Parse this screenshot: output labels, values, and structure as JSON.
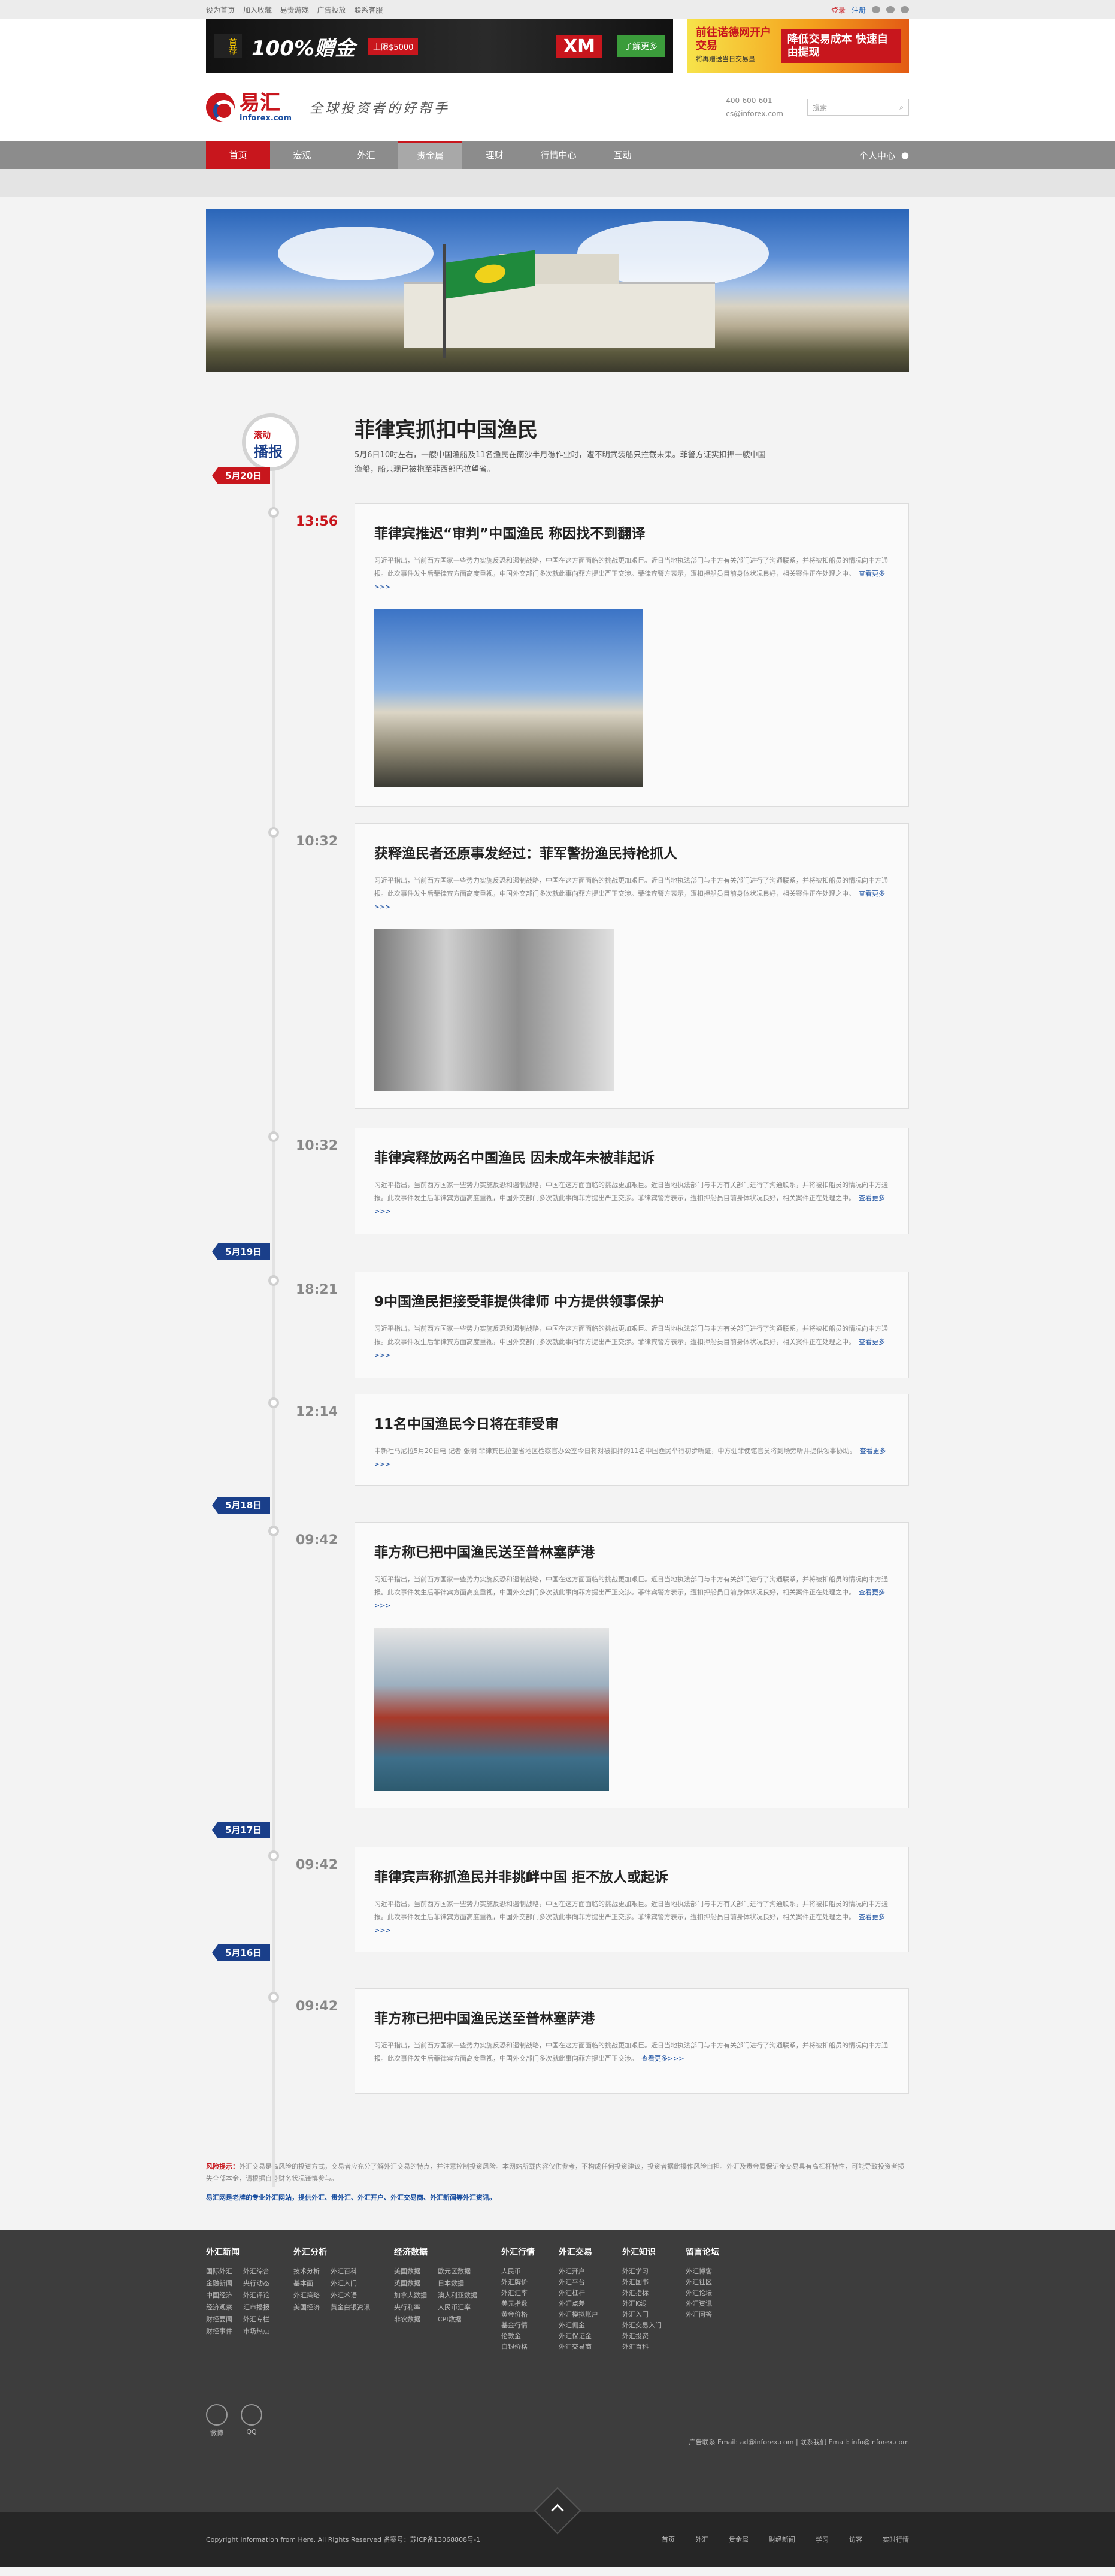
{
  "topbar": {
    "links": [
      "设为首页",
      "加入收藏",
      "易贵游戏",
      "广告投放",
      "联系客服"
    ],
    "register": "登录",
    "login": "注册"
  },
  "ads": {
    "ad1_label": "首荐",
    "ad1_big": "100%赠金",
    "ad1_sub": "上限$5000",
    "ad1_brand": "XM",
    "ad1_go": "了解更多",
    "ad2_left": "前往诺德网开户交易",
    "ad2_left_small": "将再赠送当日交易量",
    "ad2_right": "降低交易成本 快速自由提现"
  },
  "header": {
    "logo_cn": "易汇",
    "logo_en": "inforex.com",
    "slogan": "全球投资者的好帮手",
    "phone": "400-600-601",
    "email": "cs@inforex.com",
    "search_placeholder": "搜索"
  },
  "nav": {
    "items": [
      "首页",
      "宏观",
      "外汇",
      "贵金属",
      "理财",
      "行情中心",
      "互动"
    ],
    "user": "个人中心"
  },
  "article": {
    "badge_1": "滚动",
    "badge_2": "播报",
    "title": "菲律宾抓扣中国渔民",
    "lead": "5月6日10时左右，一艘中国渔船及11名渔民在南沙半月礁作业时，遭不明武装船只拦截未果。菲警方证实扣押一艘中国渔船，船只现已被拖至菲西部巴拉望省。"
  },
  "dates": [
    "5月20日",
    "5月19日",
    "5月18日",
    "5月17日",
    "5月16日"
  ],
  "entries": [
    {
      "time": "13:56",
      "title": "菲律宾推迟“审判”中国渔民 称因找不到翻译",
      "body": "习近平指出，当前西方国家一些势力实施反恐和遏制战略，中国在这方面面临的挑战更加艰巨。近日当地执法部门与中方有关部门进行了沟通联系，并将被扣船员的情况向中方通报。此次事件发生后菲律宾方面高度重视，中国外交部门多次就此事向菲方提出严正交涉。菲律宾警方表示，遭扣押船员目前身体状况良好，相关案件正在处理之中。",
      "more": "查看更多>>>"
    },
    {
      "time": "10:32",
      "title": "获释渔民者还原事发经过：菲军警扮渔民持枪抓人",
      "body": "习近平指出，当前西方国家一些势力实施反恐和遏制战略，中国在这方面面临的挑战更加艰巨。近日当地执法部门与中方有关部门进行了沟通联系，并将被扣船员的情况向中方通报。此次事件发生后菲律宾方面高度重视，中国外交部门多次就此事向菲方提出严正交涉。菲律宾警方表示，遭扣押船员目前身体状况良好，相关案件正在处理之中。",
      "more": "查看更多>>>"
    },
    {
      "time": "10:32",
      "title": "菲律宾释放两名中国渔民 因未成年未被菲起诉",
      "body": "习近平指出，当前西方国家一些势力实施反恐和遏制战略，中国在这方面面临的挑战更加艰巨。近日当地执法部门与中方有关部门进行了沟通联系，并将被扣船员的情况向中方通报。此次事件发生后菲律宾方面高度重视，中国外交部门多次就此事向菲方提出严正交涉。菲律宾警方表示，遭扣押船员目前身体状况良好，相关案件正在处理之中。",
      "more": "查看更多>>>"
    },
    {
      "time": "18:21",
      "title": "9中国渔民拒接受菲提供律师 中方提供领事保护",
      "body": "习近平指出，当前西方国家一些势力实施反恐和遏制战略，中国在这方面面临的挑战更加艰巨。近日当地执法部门与中方有关部门进行了沟通联系，并将被扣船员的情况向中方通报。此次事件发生后菲律宾方面高度重视，中国外交部门多次就此事向菲方提出严正交涉。菲律宾警方表示，遭扣押船员目前身体状况良好，相关案件正在处理之中。",
      "more": "查看更多>>>"
    },
    {
      "time": "12:14",
      "title": "11名中国渔民今日将在菲受审",
      "body": "中新社马尼拉5月20日电 记者 张明 菲律宾巴拉望省地区检察官办公室今日将对被扣押的11名中国渔民举行初步听证，中方驻菲使馆官员将到场旁听并提供领事协助。",
      "more": "查看更多>>>"
    },
    {
      "time": "09:42",
      "title": "菲方称已把中国渔民送至普林塞萨港",
      "body": "习近平指出，当前西方国家一些势力实施反恐和遏制战略，中国在这方面面临的挑战更加艰巨。近日当地执法部门与中方有关部门进行了沟通联系，并将被扣船员的情况向中方通报。此次事件发生后菲律宾方面高度重视，中国外交部门多次就此事向菲方提出严正交涉。菲律宾警方表示，遭扣押船员目前身体状况良好，相关案件正在处理之中。",
      "more": "查看更多>>>"
    },
    {
      "time": "09:42",
      "title": "菲律宾声称抓渔民并非挑衅中国 拒不放人或起诉",
      "body": "习近平指出，当前西方国家一些势力实施反恐和遏制战略，中国在这方面面临的挑战更加艰巨。近日当地执法部门与中方有关部门进行了沟通联系，并将被扣船员的情况向中方通报。此次事件发生后菲律宾方面高度重视，中国外交部门多次就此事向菲方提出严正交涉。菲律宾警方表示，遭扣押船员目前身体状况良好，相关案件正在处理之中。",
      "more": "查看更多>>>"
    },
    {
      "time": "09:42",
      "title": "菲方称已把中国渔民送至普林塞萨港",
      "body": "习近平指出，当前西方国家一些势力实施反恐和遏制战略，中国在这方面面临的挑战更加艰巨。近日当地执法部门与中方有关部门进行了沟通联系，并将被扣船员的情况向中方通报。此次事件发生后菲律宾方面高度重视，中国外交部门多次就此事向菲方提出严正交涉。",
      "more": "查看更多>>>"
    }
  ],
  "risk": {
    "label": "风险提示：",
    "text": "外汇交易是高风险的投资方式，交易者应充分了解外汇交易的特点，并注意控制投资风险。本网站所载内容仅供参考，不构成任何投资建议，投资者据此操作风险自担。外汇及贵金属保证金交易具有高杠杆特性，可能导致投资者损失全部本金，请根据自身财务状况谨慎参与。",
    "tagline": "易汇网是老牌的专业外汇网站，提供外汇、贵外汇、外汇开户、外汇交易商、外汇新闻等外汇资讯。"
  },
  "footer": {
    "cols": [
      {
        "title": "外汇新闻",
        "items": [
          "国际外汇",
          "外汇综合",
          "金融新闻",
          "央行动态",
          "中国经济",
          "外汇评论",
          "经济观察",
          "汇市播报",
          "财经要闻",
          "外汇专栏",
          "财经事件",
          "市场热点"
        ]
      },
      {
        "title": "外汇分析",
        "items": [
          "技术分析",
          "外汇百科",
          "基本面",
          "外汇入门",
          "外汇策略",
          "外汇术语",
          "美国经济",
          "黄金白银资讯"
        ]
      },
      {
        "title": "经济数据",
        "items": [
          "美国数据",
          "欧元区数据",
          "英国数据",
          "日本数据",
          "加拿大数据",
          "澳大利亚数据",
          "央行利率",
          "人民币汇率",
          "非农数据",
          "CPI数据"
        ]
      },
      {
        "title": "外汇行情",
        "items": [
          "人民币",
          "外汇牌价",
          "外汇汇率",
          "美元指数",
          "黄金价格",
          "基金行情",
          "伦敦金",
          "白银价格"
        ]
      },
      {
        "title": "外汇交易",
        "items": [
          "外汇开户",
          "外汇平台",
          "外汇杠杆",
          "外汇点差",
          "外汇模拟账户",
          "外汇佣金",
          "外汇保证金",
          "外汇交易商"
        ]
      },
      {
        "title": "外汇知识",
        "items": [
          "外汇学习",
          "外汇图书",
          "外汇指标",
          "外汇K线",
          "外汇入门",
          "外汇交易入门",
          "外汇投资",
          "外汇百科"
        ]
      },
      {
        "title": "留言论坛",
        "items": [
          "外汇博客",
          "外汇社区",
          "外汇论坛",
          "外汇资讯",
          "外汇问答"
        ]
      }
    ],
    "social": [
      "微博",
      "QQ"
    ],
    "contact": "广告联系 Email: ad@inforex.com | 联系我们 Email: info@inforex.com"
  },
  "bottom": {
    "copyright": "Copyright Information from Here. All Rights Reserved 备案号：苏ICP备13068808号-1",
    "links": [
      "首页",
      "外汇",
      "贵金属",
      "财经新闻",
      "学习",
      "访客",
      "实时行情"
    ]
  }
}
